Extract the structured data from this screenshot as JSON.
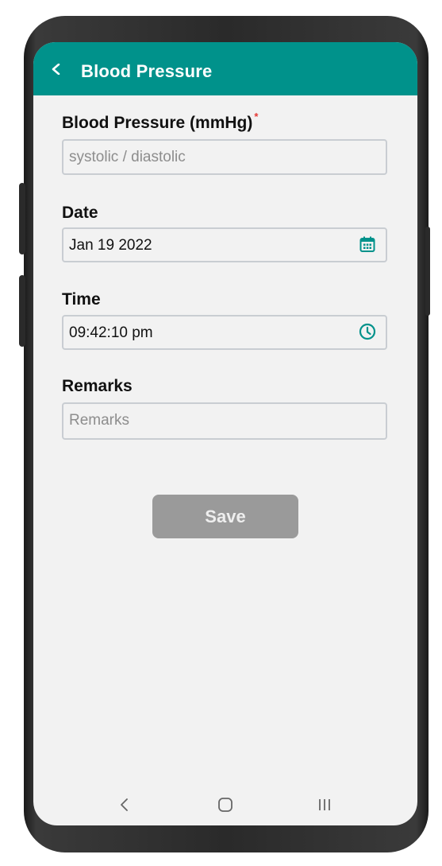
{
  "header": {
    "title": "Blood Pressure"
  },
  "form": {
    "blood_pressure": {
      "label": "Blood Pressure (mmHg)",
      "required_mark": "*",
      "value": "",
      "placeholder": "systolic / diastolic"
    },
    "date": {
      "label": "Date",
      "value": "Jan 19 2022",
      "icon": "calendar-icon"
    },
    "time": {
      "label": "Time",
      "value": "09:42:10 pm",
      "icon": "clock-icon"
    },
    "remarks": {
      "label": "Remarks",
      "value": "",
      "placeholder": "Remarks"
    },
    "save_label": "Save"
  },
  "navbar": {
    "back_icon": "nav-back-icon",
    "home_icon": "nav-home-icon",
    "recents_icon": "nav-recents-icon"
  },
  "colors": {
    "accent": "#00928b",
    "required": "#e53935",
    "disabled_button": "#9a9a9a",
    "field_border": "#c9cdd2",
    "screen_background": "#f2f2f2"
  }
}
